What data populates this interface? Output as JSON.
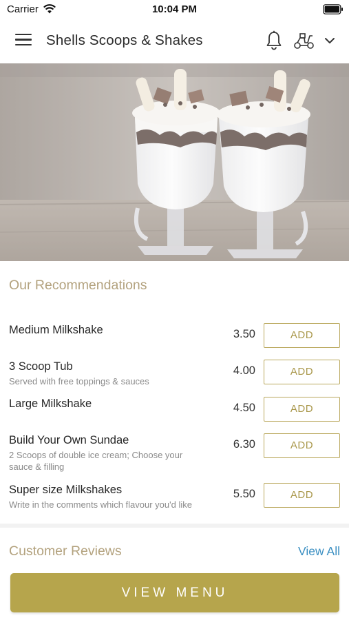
{
  "status_bar": {
    "carrier": "Carrier",
    "time": "10:04 PM"
  },
  "header": {
    "title": "Shells Scoops & Shakes",
    "icons": [
      "hamburger-menu-icon",
      "bell-icon",
      "scooter-icon",
      "chevron-down-icon"
    ]
  },
  "hero": {
    "image": "milkshakes-photo"
  },
  "recommendations": {
    "title": "Our Recommendations",
    "items": [
      {
        "name": "Medium Milkshake",
        "description": "",
        "price": "3.50",
        "button": "ADD"
      },
      {
        "name": "3 Scoop Tub",
        "description": "Served with free toppings & sauces",
        "price": "4.00",
        "button": "ADD"
      },
      {
        "name": "Large Milkshake",
        "description": "",
        "price": "4.50",
        "button": "ADD"
      },
      {
        "name": "Build Your Own Sundae",
        "description": "2 Scoops of double ice cream; Choose your sauce & filling",
        "price": "6.30",
        "button": "ADD"
      },
      {
        "name": "Super size Milkshakes",
        "description": "Write in the comments which flavour you'd like",
        "price": "5.50",
        "button": "ADD"
      }
    ]
  },
  "reviews": {
    "title": "Customer Reviews",
    "view_all": "View All"
  },
  "footer": {
    "view_menu": "VIEW MENU"
  },
  "colors": {
    "accent_gold": "#b6a54c",
    "section_title": "#b3a27e",
    "link_blue": "#3a8fc2"
  }
}
